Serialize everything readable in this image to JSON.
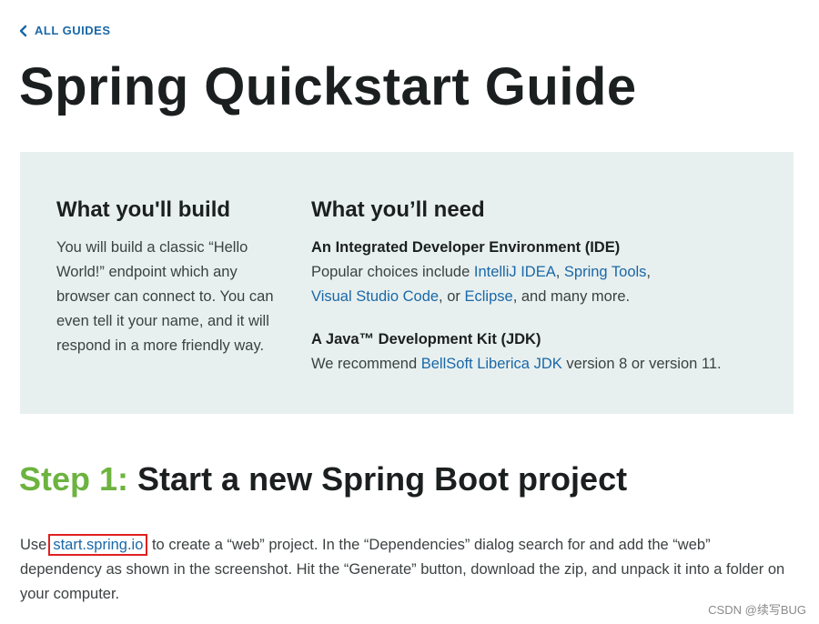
{
  "nav": {
    "back_label": "ALL GUIDES",
    "back_icon": "chevron-left-icon"
  },
  "page_title": "Spring Quickstart Guide",
  "build": {
    "title": "What you'll build",
    "text": "You will build a classic “Hello World!” endpoint which any browser can connect to. You can even tell it your name, and it will respond in a more friendly way."
  },
  "need": {
    "title": "What you’ll need",
    "ide": {
      "heading": "An Integrated Developer Environment (IDE)",
      "prefix": "Popular choices include ",
      "links": [
        "IntelliJ IDEA",
        "Spring Tools",
        "Visual Studio Code",
        "Eclipse"
      ],
      "sep1": ", ",
      "sep2": ",",
      "sep3": ", or ",
      "suffix": ", and many more."
    },
    "jdk": {
      "heading": "A Java™ Development Kit (JDK)",
      "prefix": "We recommend ",
      "link": "BellSoft Liberica JDK",
      "suffix": " version 8 or version 11."
    }
  },
  "step1": {
    "label": "Step 1:",
    "title": " Start a new Spring Boot project",
    "para_prefix": "Use",
    "link": "start.spring.io",
    "para_suffix": " to create a “web” project. In the “Dependencies” dialog search for and add the “web” dependency as shown in the screenshot. Hit the “Generate” button, download the zip, and unpack it into a folder on your computer."
  },
  "watermark": "CSDN @续写BUG",
  "colors": {
    "link": "#1a68a8",
    "step_green": "#6db33f",
    "box_bg": "#e8f0ef",
    "highlight_border": "#e02020"
  }
}
